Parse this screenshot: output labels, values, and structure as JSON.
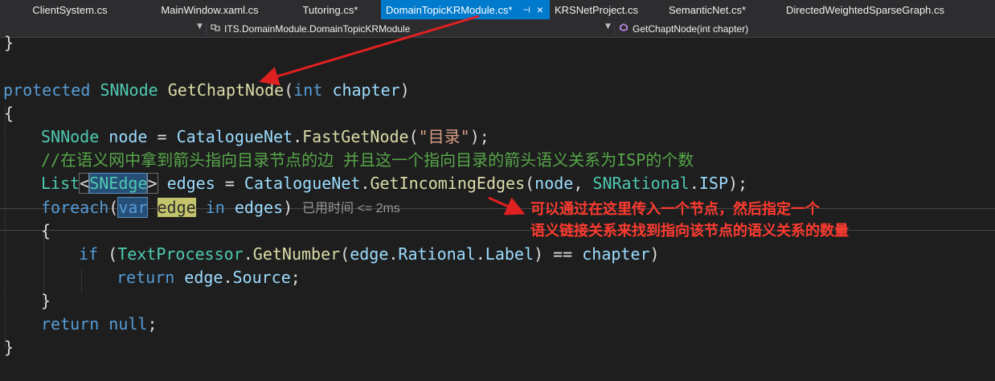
{
  "tabs": [
    {
      "label": "ClientSystem.cs",
      "active": false
    },
    {
      "label": "MainWindow.xaml.cs",
      "active": false
    },
    {
      "label": "Tutoring.cs*",
      "active": false
    },
    {
      "label": "DomainTopicKRModule.cs*",
      "active": true
    },
    {
      "label": "KRSNetProject.cs",
      "active": false
    },
    {
      "label": "SemanticNet.cs*",
      "active": false
    },
    {
      "label": "DirectedWeightedSparseGraph.cs",
      "active": false
    }
  ],
  "tab_pin_icon": "pin-icon",
  "tab_close_icon": "close-icon",
  "navbar": {
    "class_path": "ITS.DomainModule.DomainTopicKRModule",
    "member": "GetChaptNode(int chapter)"
  },
  "code": {
    "l0_brace": "}",
    "l1_kw": "protected",
    "l1_type": "SNNode",
    "l1_method": "GetChaptNode",
    "l1_paren_open": "(",
    "l1_int": "int",
    "l1_param": "chapter",
    "l1_paren_close": ")",
    "l2_brace": "{",
    "l3_type": "SNNode",
    "l3_var": "node",
    "l3_eq": " = ",
    "l3_obj": "CatalogueNet",
    "l3_dot": ".",
    "l3_method": "FastGetNode",
    "l3_open": "(",
    "l3_str": "\"目录\"",
    "l3_close": ");",
    "l4_comment": "//在语义网中拿到箭头指向目录节点的边 并且这一个指向目录的箭头语义关系为ISP的个数",
    "l5_list": "List",
    "l5_lt": "<",
    "l5_generic": "SNEdge",
    "l5_gt": ">",
    "l5_var": "edges",
    "l5_eq": " = ",
    "l5_obj": "CatalogueNet",
    "l5_dot": ".",
    "l5_method": "GetIncomingEdges",
    "l5_open": "(",
    "l5_arg1": "node",
    "l5_comma": ", ",
    "l5_enum": "SNRational",
    "l5_dot2": ".",
    "l5_member": "ISP",
    "l5_close": ");",
    "l6_foreach": "foreach",
    "l6_open": "(",
    "l6_var_kw": "var",
    "l6_edge": "edge",
    "l6_in": "in",
    "l6_edges": "edges",
    "l6_close": ")",
    "l7_brace": "{",
    "l8_if": "if",
    "l8_open": " (",
    "l8_type": "TextProcessor",
    "l8_dot": ".",
    "l8_method": "GetNumber",
    "l8_paren": "(",
    "l8_edge": "edge",
    "l8_dot2": ".",
    "l8_prop1": "Rational",
    "l8_dot3": ".",
    "l8_prop2": "Label",
    "l8_cmp": ") == ",
    "l8_chapter": "chapter",
    "l8_close": ")",
    "l9_return": "return",
    "l9_edge": "edge",
    "l9_dot": ".",
    "l9_prop": "Source",
    "l9_semi": ";",
    "l10_brace": "}",
    "l11_return": "return",
    "l11_null": "null",
    "l11_semi": ";",
    "l12_brace": "}"
  },
  "perf_tip": "已用时间 <= 2ms",
  "annotation": {
    "line1": "可以通过在这里传入一个节点，然后指定一个",
    "line2": "语义链接关系来找到指向该节点的语义关系的数量"
  },
  "colors": {
    "background": "#1e1e1e",
    "active_tab": "#007acc",
    "keyword": "#569cd6",
    "type": "#4ec9b0",
    "string": "#d69d85",
    "comment": "#57a64a",
    "annotation": "#ff3b30"
  }
}
